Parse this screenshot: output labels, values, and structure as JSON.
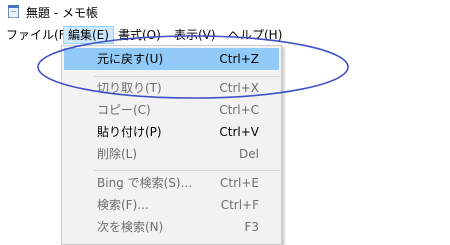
{
  "window": {
    "title": "無題 - メモ帳"
  },
  "menubar": [
    {
      "label": "ファイル(F)"
    },
    {
      "label": "編集(E)"
    },
    {
      "label": "書式(O)"
    },
    {
      "label": "表示(V)"
    },
    {
      "label": "ヘルプ(H)"
    }
  ],
  "edit_menu": [
    {
      "label": "元に戻す(U)",
      "shortcut": "Ctrl+Z",
      "enabled": true,
      "highlighted": true
    },
    {
      "label": "切り取り(T)",
      "shortcut": "Ctrl+X",
      "enabled": false
    },
    {
      "label": "コピー(C)",
      "shortcut": "Ctrl+C",
      "enabled": false
    },
    {
      "label": "貼り付け(P)",
      "shortcut": "Ctrl+V",
      "enabled": true
    },
    {
      "label": "削除(L)",
      "shortcut": "Del",
      "enabled": false
    },
    {
      "label": "Bing で検索(S)...",
      "shortcut": "Ctrl+E",
      "enabled": false
    },
    {
      "label": "検索(F)...",
      "shortcut": "Ctrl+F",
      "enabled": false
    },
    {
      "label": "次を検索(N)",
      "shortcut": "F3",
      "enabled": false
    }
  ],
  "colors": {
    "highlight": "#91c9f7",
    "active_menu": "#cce8ff",
    "annotation": "#3f51c6",
    "disabled_text": "#6d6d6d"
  }
}
